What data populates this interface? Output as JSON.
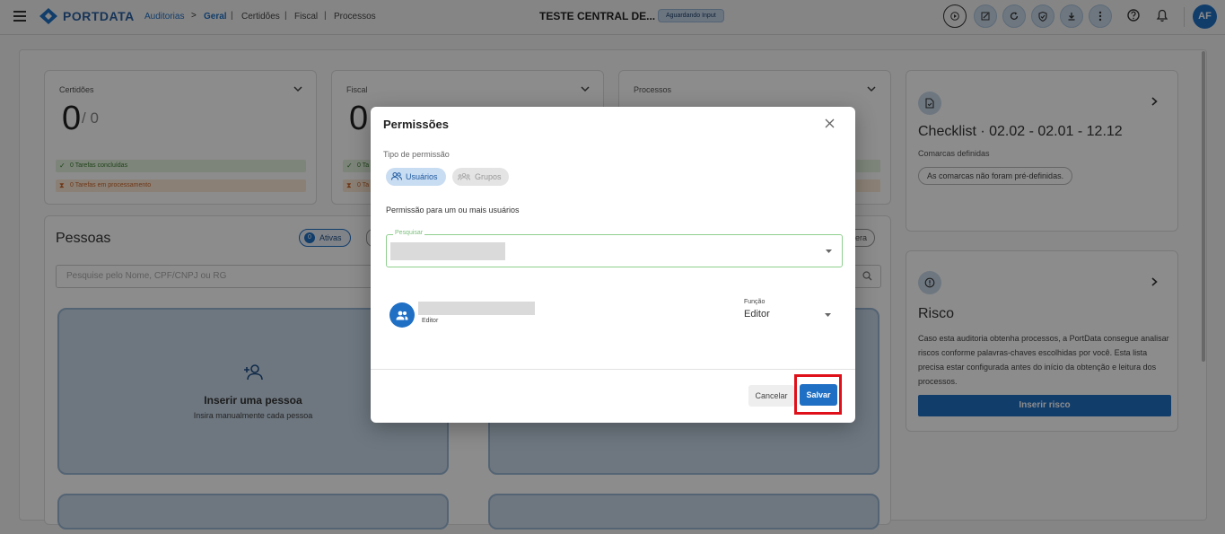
{
  "topbar": {
    "logo_text": "PORTDATA",
    "breadcrumb": {
      "root": "Auditorias",
      "sep": ">",
      "current": "Geral",
      "items": [
        "Certidões",
        "Fiscal",
        "Processos"
      ],
      "divider": "|"
    },
    "title": "TESTE CENTRAL DE...",
    "status_badge": "Aguardando Input",
    "avatar": "AF"
  },
  "cards": {
    "certidoes": {
      "label": "Certidões",
      "count": "0",
      "total": "/ 0",
      "done": "0 Tarefas concluídas",
      "processing": "0 Tarefas em processamento"
    },
    "fiscal": {
      "label": "Fiscal",
      "count": "0",
      "done": "0 Ta",
      "processing": "0 Ta"
    },
    "processos": {
      "label": "Processos"
    },
    "checklist": {
      "title": "Checklist · 02.02 - 02.01 - 12.12",
      "subtitle": "Comarcas definidas",
      "chip": "As comarcas não foram pré-definidas."
    },
    "risco": {
      "title": "Risco",
      "description": "Caso esta auditoria obtenha processos, a PortData consegue analisar riscos conforme palavras-chaves escolhidas por você. Esta lista precisa estar configurada antes do início da obtenção e leitura dos processos.",
      "button": "Inserir risco"
    }
  },
  "pessoas": {
    "title": "Pessoas",
    "active_count": "0",
    "active_label": "Ativas",
    "right_chip": "era",
    "search_placeholder": "Pesquise pelo Nome, CPF/CNPJ ou RG",
    "insert_title": "Inserir uma pessoa",
    "insert_subtitle": "Insira manualmente cada pessoa"
  },
  "modal": {
    "title": "Permissões",
    "type_label": "Tipo de permissão",
    "tab_users": "Usuários",
    "tab_groups": "Grupos",
    "help_text": "Permissão para um ou mais usuários",
    "search_label": "Pesquisar",
    "user_role": "Editor",
    "role_label": "Função",
    "role_value": "Editor",
    "cancel": "Cancelar",
    "save": "Salvar"
  },
  "colors": {
    "brand": "#1f6fc4",
    "highlight": "#e0101a",
    "success_bg": "#e3f3df",
    "warning_bg": "#fde9d6"
  }
}
